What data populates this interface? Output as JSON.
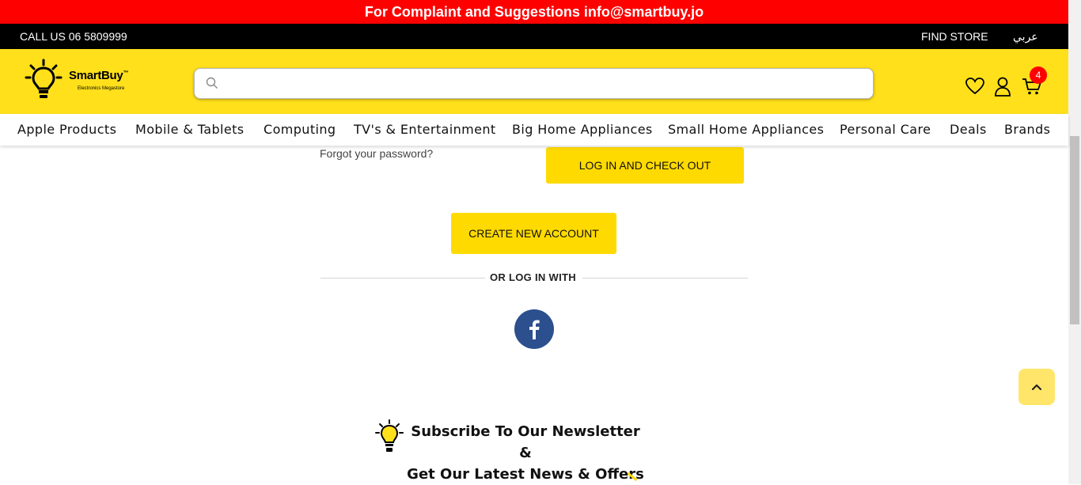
{
  "announcement": {
    "text": "For Complaint and Suggestions info@smartbuy.jo"
  },
  "topbar": {
    "call": "CALL US 06 5809999",
    "find_store": "FIND STORE",
    "language": "عربي"
  },
  "logo": {
    "brand": "SmartBuy",
    "tm": "™",
    "tagline": "Electronics Megastore"
  },
  "search": {
    "placeholder": "",
    "value": ""
  },
  "header_icons": {
    "cart_count": "4"
  },
  "nav": {
    "items": [
      "Apple Products",
      "Mobile & Tablets",
      "Computing",
      "TV's & Entertainment",
      "Big Home Appliances",
      "Small Home Appliances",
      "Personal Care",
      "Deals",
      "Brands"
    ]
  },
  "login": {
    "forgot_password": "Forgot your password?",
    "login_checkout": "LOG IN AND CHECK OUT",
    "create_account": "CREATE NEW ACCOUNT",
    "or_login_with": "OR LOG IN WITH"
  },
  "newsletter": {
    "line1": "Subscribe To Our Newsletter &",
    "line2": "Get Our Latest News & Offers"
  },
  "colors": {
    "brand_yellow": "#ffe01b",
    "button_yellow": "#ffda00",
    "alert_red": "#ff0000",
    "facebook_blue": "#2c4f8e"
  }
}
